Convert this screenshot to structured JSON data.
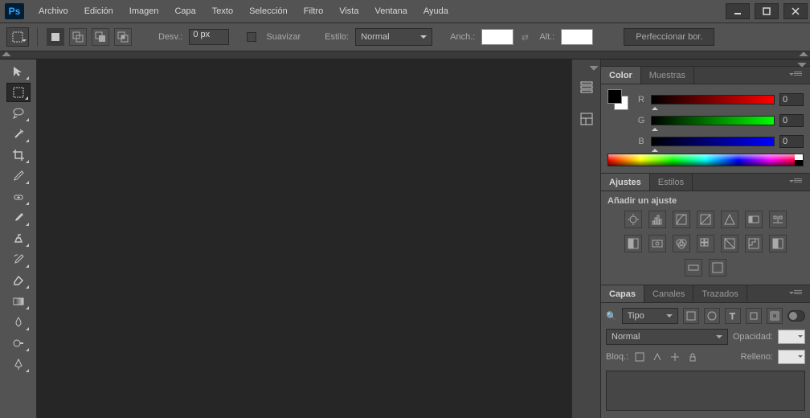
{
  "app": {
    "logo": "Ps"
  },
  "menu": {
    "items": [
      "Archivo",
      "Edición",
      "Imagen",
      "Capa",
      "Texto",
      "Selección",
      "Filtro",
      "Vista",
      "Ventana",
      "Ayuda"
    ]
  },
  "options": {
    "desv_label": "Desv.:",
    "desv_value": "0 px",
    "suavizar_label": "Suavizar",
    "estilo_label": "Estilo:",
    "estilo_value": "Normal",
    "anch_label": "Anch.:",
    "alt_label": "Alt.:",
    "refine_label": "Perfeccionar bor."
  },
  "panels": {
    "color": {
      "tab_color": "Color",
      "tab_muestras": "Muestras",
      "r_label": "R",
      "r_value": "0",
      "g_label": "G",
      "g_value": "0",
      "b_label": "B",
      "b_value": "0"
    },
    "adjustments": {
      "tab_ajustes": "Ajustes",
      "tab_estilos": "Estilos",
      "title": "Añadir un ajuste"
    },
    "layers": {
      "tab_capas": "Capas",
      "tab_canales": "Canales",
      "tab_trazados": "Trazados",
      "filter_kind_label": "Tipo",
      "blend_mode": "Normal",
      "opacity_label": "Opacidad:",
      "lock_label": "Bloq.:",
      "fill_label": "Relleno:"
    }
  }
}
